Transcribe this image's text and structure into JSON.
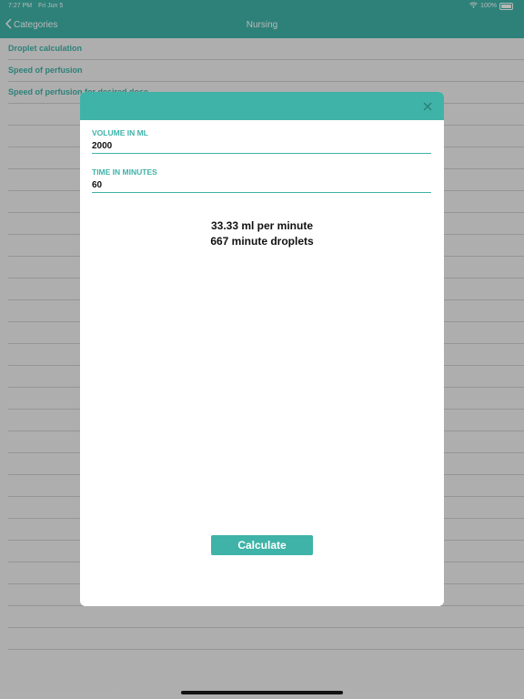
{
  "status": {
    "time": "7:27 PM",
    "date": "Fri Jun 5",
    "battery": "100%"
  },
  "nav": {
    "back_label": "Categories",
    "title": "Nursing"
  },
  "list": {
    "items": [
      "Droplet calculation",
      "Speed of perfusion",
      "Speed of perfusion for desired dose"
    ],
    "empty_rows": 25
  },
  "modal": {
    "volume": {
      "label": "VOLUME IN ML",
      "value": "2000"
    },
    "time": {
      "label": "TIME IN MINUTES",
      "value": "60"
    },
    "results": [
      "33.33 ml per minute",
      "667 minute droplets"
    ],
    "calculate_label": "Calculate"
  },
  "colors": {
    "accent": "#3fb3a8"
  }
}
